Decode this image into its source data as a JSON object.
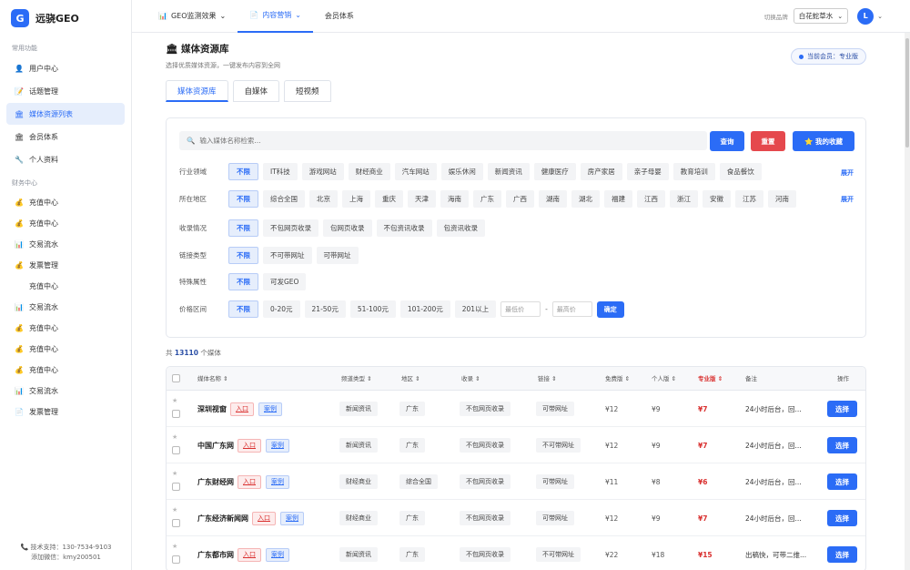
{
  "brand": {
    "logo": "G",
    "name": "远骁GEO"
  },
  "sidebar": {
    "section1": "常用功能",
    "items1": [
      {
        "label": "用户中心",
        "icon": "user-icon",
        "glyph": "👤"
      },
      {
        "label": "话题管理",
        "icon": "topic-icon",
        "glyph": "📝"
      },
      {
        "label": "媒体资源列表",
        "icon": "media-icon",
        "glyph": "🏛"
      },
      {
        "label": "会员体系",
        "icon": "member-icon",
        "glyph": "🏛"
      },
      {
        "label": "个人资料",
        "icon": "profile-icon",
        "glyph": "🔧"
      }
    ],
    "section2": "财务中心",
    "items2": [
      {
        "label": "充值中心",
        "icon": "recharge-icon",
        "glyph": "💰"
      },
      {
        "label": "充值中心",
        "icon": "recharge-icon",
        "glyph": "💰"
      },
      {
        "label": "交易流水",
        "icon": "chart-icon",
        "glyph": "📊"
      },
      {
        "label": "发票管理",
        "icon": "invoice-icon",
        "glyph": "💰"
      },
      {
        "label": "充值中心",
        "icon": "recharge-icon",
        "glyph": ""
      },
      {
        "label": "交易流水",
        "icon": "chart-icon",
        "glyph": "📊"
      },
      {
        "label": "充值中心",
        "icon": "recharge-icon",
        "glyph": "💰"
      },
      {
        "label": "充值中心",
        "icon": "recharge-icon",
        "glyph": "💰"
      },
      {
        "label": "充值中心",
        "icon": "recharge-icon",
        "glyph": "💰"
      },
      {
        "label": "交易流水",
        "icon": "chart-icon",
        "glyph": "📊"
      },
      {
        "label": "发票管理",
        "icon": "invoice-icon",
        "glyph": "📄"
      }
    ],
    "support": "技术支持：130-7534-9103",
    "wechat": "添加微信：kmy200501"
  },
  "topbar": {
    "tabs": [
      {
        "label": "GEO监测效果",
        "glyph": "📊"
      },
      {
        "label": "内容营销",
        "glyph": "📄"
      },
      {
        "label": "会员体系",
        "glyph": ""
      }
    ],
    "brand_switch_label": "切换品牌",
    "brand_selected": "白花蛇草水",
    "avatar": "L"
  },
  "page": {
    "title": "媒体资源库",
    "subtitle": "选择优质媒体资源，一键发布内容到全网",
    "member_badge": "当前会员：专业版",
    "subtabs": [
      "媒体资源库",
      "自媒体",
      "短视频"
    ]
  },
  "filter": {
    "search_placeholder": "输入媒体名称检索...",
    "btn_query": "查询",
    "btn_reset": "重置",
    "btn_fav": "⭐ 我的收藏",
    "expand": "展开",
    "rows": [
      {
        "label": "行业领域",
        "chips": [
          "不限",
          "IT科技",
          "游戏网站",
          "财经商业",
          "汽车网站",
          "娱乐休闲",
          "新闻资讯",
          "健康医疗",
          "房产家居",
          "亲子母婴",
          "教育培训",
          "食品餐饮"
        ]
      },
      {
        "label": "所在地区",
        "chips": [
          "不限",
          "综合全国",
          "北京",
          "上海",
          "重庆",
          "天津",
          "海南",
          "广东",
          "广西",
          "湖南",
          "湖北",
          "福建",
          "江西",
          "浙江",
          "安徽",
          "江苏",
          "河南"
        ]
      },
      {
        "label": "收录情况",
        "chips": [
          "不限",
          "不包网页收录",
          "包网页收录",
          "不包资讯收录",
          "包资讯收录"
        ]
      },
      {
        "label": "链接类型",
        "chips": [
          "不限",
          "不可带网址",
          "可带网址"
        ]
      },
      {
        "label": "特殊属性",
        "chips": [
          "不限",
          "可发GEO"
        ]
      },
      {
        "label": "价格区间",
        "chips": [
          "不限",
          "0-20元",
          "21-50元",
          "51-100元",
          "101-200元",
          "201以上"
        ]
      }
    ],
    "price_min": "最低价",
    "price_max": "最高价",
    "dash": "-",
    "btn_confirm": "确定"
  },
  "total": {
    "prefix": "共",
    "count": "13110",
    "suffix": "个媒体"
  },
  "table": {
    "headers": [
      "媒体名称 ⇕",
      "频道类型 ⇕",
      "地区 ⇕",
      "收录 ⇕",
      "链接 ⇕",
      "免费版 ⇕",
      "个人版 ⇕",
      "专业版 ⇕",
      "备注",
      "操作"
    ],
    "tag_in": "入口",
    "tag_case": "案例",
    "select": "选择",
    "star": "★",
    "rows": [
      {
        "name": "深圳视窗",
        "channel": "新闻资讯",
        "region": "广东",
        "index": "不包网页收录",
        "link": "可带网址",
        "free": "¥12",
        "personal": "¥9",
        "pro": "¥7",
        "note": "24小时后台，回..."
      },
      {
        "name": "中国广东网",
        "channel": "新闻资讯",
        "region": "广东",
        "index": "不包网页收录",
        "link": "不可带网址",
        "free": "¥12",
        "personal": "¥9",
        "pro": "¥7",
        "note": "24小时后台，回..."
      },
      {
        "name": "广东财经网",
        "channel": "财经商业",
        "region": "综合全国",
        "index": "不包网页收录",
        "link": "可带网址",
        "free": "¥11",
        "personal": "¥8",
        "pro": "¥6",
        "note": "24小时后台，回..."
      },
      {
        "name": "广东经济新闻网",
        "channel": "财经商业",
        "region": "广东",
        "index": "不包网页收录",
        "link": "可带网址",
        "free": "¥12",
        "personal": "¥9",
        "pro": "¥7",
        "note": "24小时后台，回..."
      },
      {
        "name": "广东都市网",
        "channel": "新闻资讯",
        "region": "广东",
        "index": "不包网页收录",
        "link": "不可带网址",
        "free": "¥22",
        "personal": "¥18",
        "pro": "¥15",
        "note": "出稿快，可带二维..."
      }
    ]
  }
}
